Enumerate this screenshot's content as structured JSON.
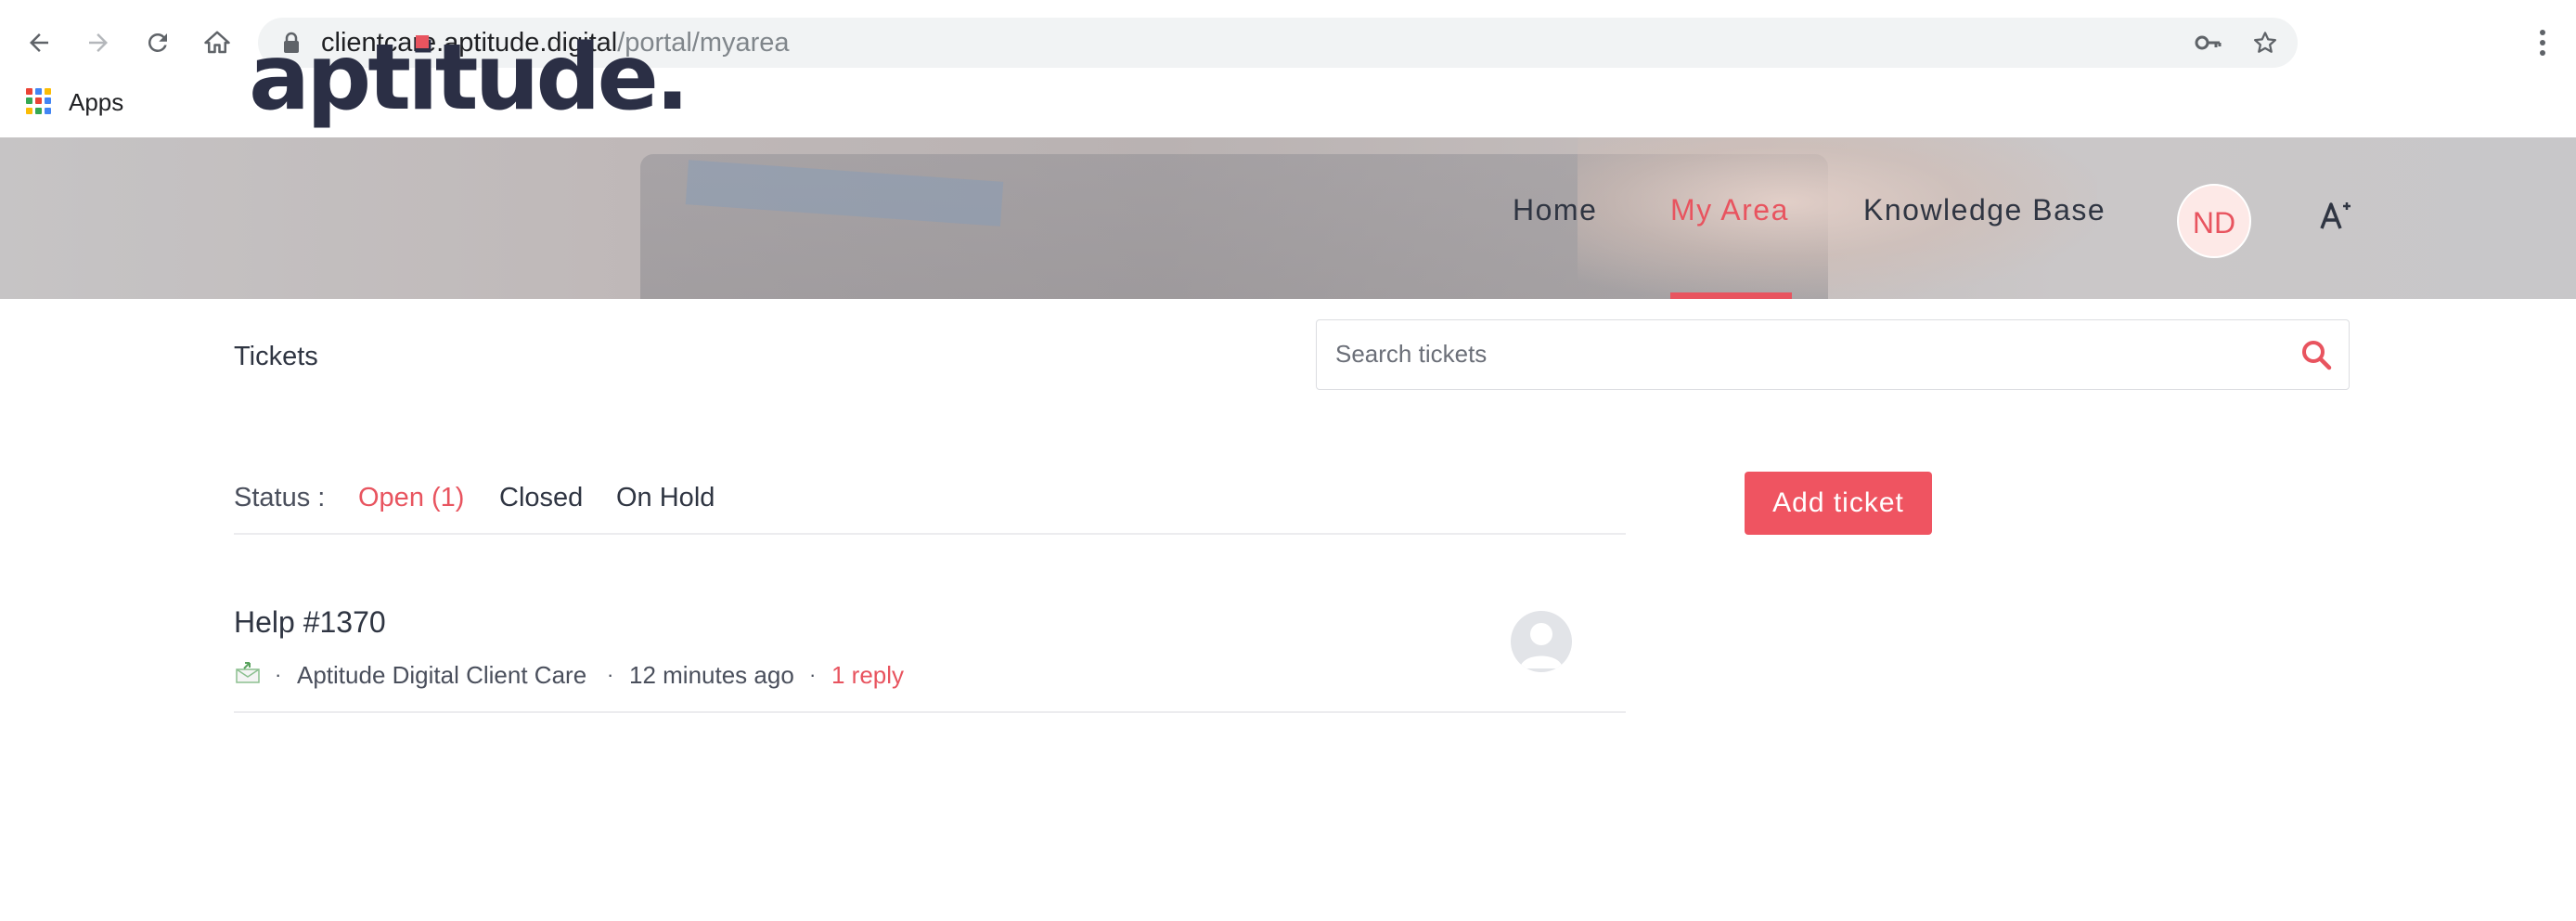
{
  "browser": {
    "url_host": "clientcare.aptitude.digital",
    "url_path": "/portal/myarea",
    "bookmarks": [
      {
        "label": "Apps"
      }
    ],
    "colors": {
      "tab_strip": "#ffffff",
      "omnibox": "#f1f3f4"
    }
  },
  "site": {
    "logo_text": "aptitude.",
    "nav": [
      {
        "label": "Home",
        "active": false
      },
      {
        "label": "My Area",
        "active": true
      },
      {
        "label": "Knowledge Base",
        "active": false
      }
    ],
    "user_initials": "ND",
    "colors": {
      "accent": "#e8545f",
      "text": "#2f3542",
      "button": "#ef5461"
    }
  },
  "tickets": {
    "title": "Tickets",
    "search_placeholder": "Search tickets",
    "status_label": "Status :",
    "filters": [
      {
        "label": "Open (1)",
        "active": true
      },
      {
        "label": "Closed",
        "active": false
      },
      {
        "label": "On Hold",
        "active": false
      }
    ],
    "add_button": "Add ticket",
    "items": [
      {
        "title": "Help #1370",
        "team": "Aptitude Digital Client Care",
        "time": "12 minutes ago",
        "replies": "1 reply",
        "channel_icon": "email-icon"
      }
    ]
  }
}
